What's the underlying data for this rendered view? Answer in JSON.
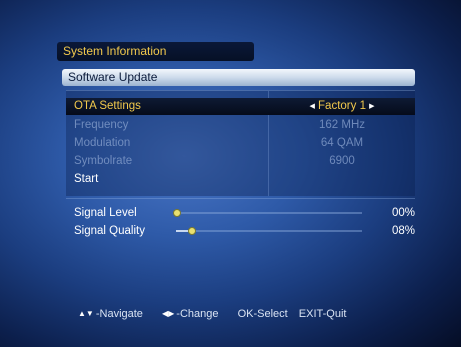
{
  "breadcrumb": "System Information",
  "title": "Software Update",
  "menu": {
    "rows": [
      {
        "label": "OTA Settings",
        "value": "Factory 1",
        "state": "selected"
      },
      {
        "label": "Frequency",
        "value": "162 MHz",
        "state": "disabled"
      },
      {
        "label": "Modulation",
        "value": "64 QAM",
        "state": "disabled"
      },
      {
        "label": "Symbolrate",
        "value": "6900",
        "state": "disabled"
      },
      {
        "label": "Start",
        "value": "",
        "state": "normal"
      }
    ]
  },
  "signal": {
    "level": {
      "label": "Signal Level",
      "percent_text": "00%",
      "percent": 0
    },
    "quality": {
      "label": "Signal Quality",
      "percent_text": "08%",
      "percent": 8
    }
  },
  "footer": {
    "navigate": "-Navigate",
    "change": "-Change",
    "ok": "OK-Select",
    "exit": "EXIT-Quit"
  },
  "icons": {
    "value_left": "left-triangle-icon",
    "value_right": "right-triangle-icon",
    "nav": "up-down-arrows-icon",
    "change": "left-right-arrows-icon"
  }
}
